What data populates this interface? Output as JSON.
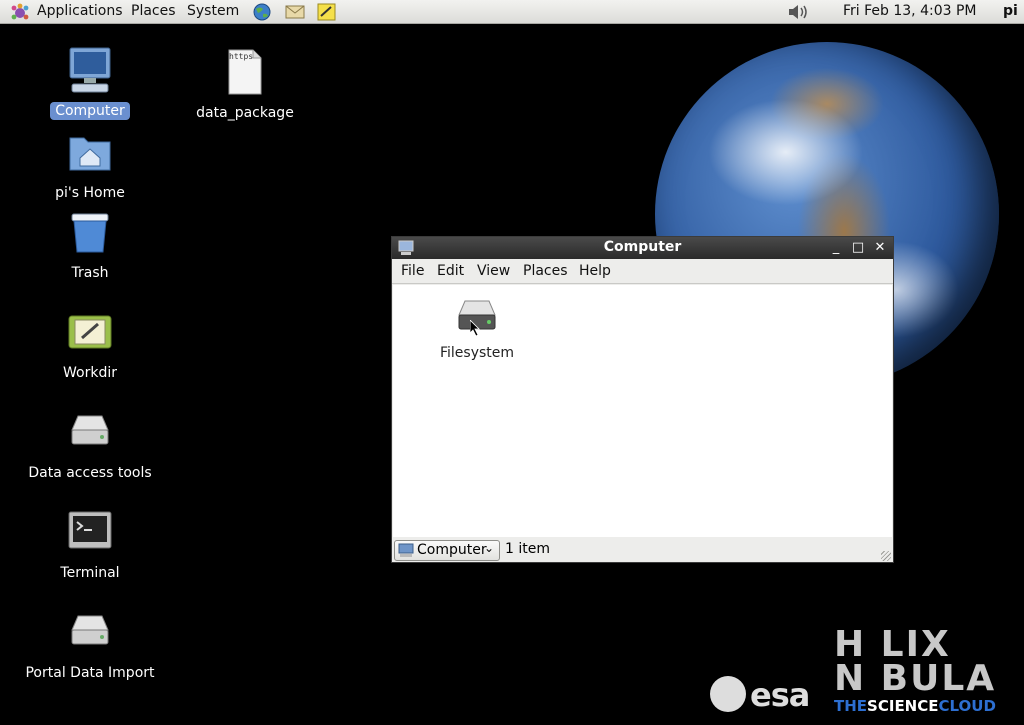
{
  "panel": {
    "menus": [
      "Applications",
      "Places",
      "System"
    ],
    "clock": "Fri Feb 13,  4:03 PM",
    "user": "pi",
    "launchers": [
      "web-browser-icon",
      "mail-icon",
      "text-editor-icon"
    ],
    "volume_icon": "volume-icon"
  },
  "desktop": {
    "icons": [
      {
        "label": "Computer",
        "icon": "computer-icon",
        "selected": true
      },
      {
        "label": "data_package",
        "icon": "file-icon",
        "file_text": "https"
      },
      {
        "label": "pi's Home",
        "icon": "home-folder-icon"
      },
      {
        "label": "Trash",
        "icon": "trash-icon"
      },
      {
        "label": "Workdir",
        "icon": "workdir-icon"
      },
      {
        "label": "Data access tools",
        "icon": "drive-icon"
      },
      {
        "label": "Terminal",
        "icon": "terminal-icon"
      },
      {
        "label": "Portal Data Import",
        "icon": "drive-icon"
      }
    ]
  },
  "window": {
    "title": "Computer",
    "menu": [
      "File",
      "Edit",
      "View",
      "Places",
      "Help"
    ],
    "items": [
      {
        "label": "Filesystem",
        "icon": "drive-icon"
      }
    ],
    "location": "Computer",
    "status": "1 item"
  },
  "logos": {
    "esa": "esa",
    "helix_line1": "H  LIX",
    "helix_line2": "N  BULA",
    "tagline_a": "THE",
    "tagline_b": "SCIENCE",
    "tagline_c": "CLOUD"
  },
  "colors": {
    "desktop_bg": "#000000",
    "selection": "#6a8fcf",
    "titlebar": "#2a2a2a",
    "helix_blue": "#2d6fd1"
  }
}
